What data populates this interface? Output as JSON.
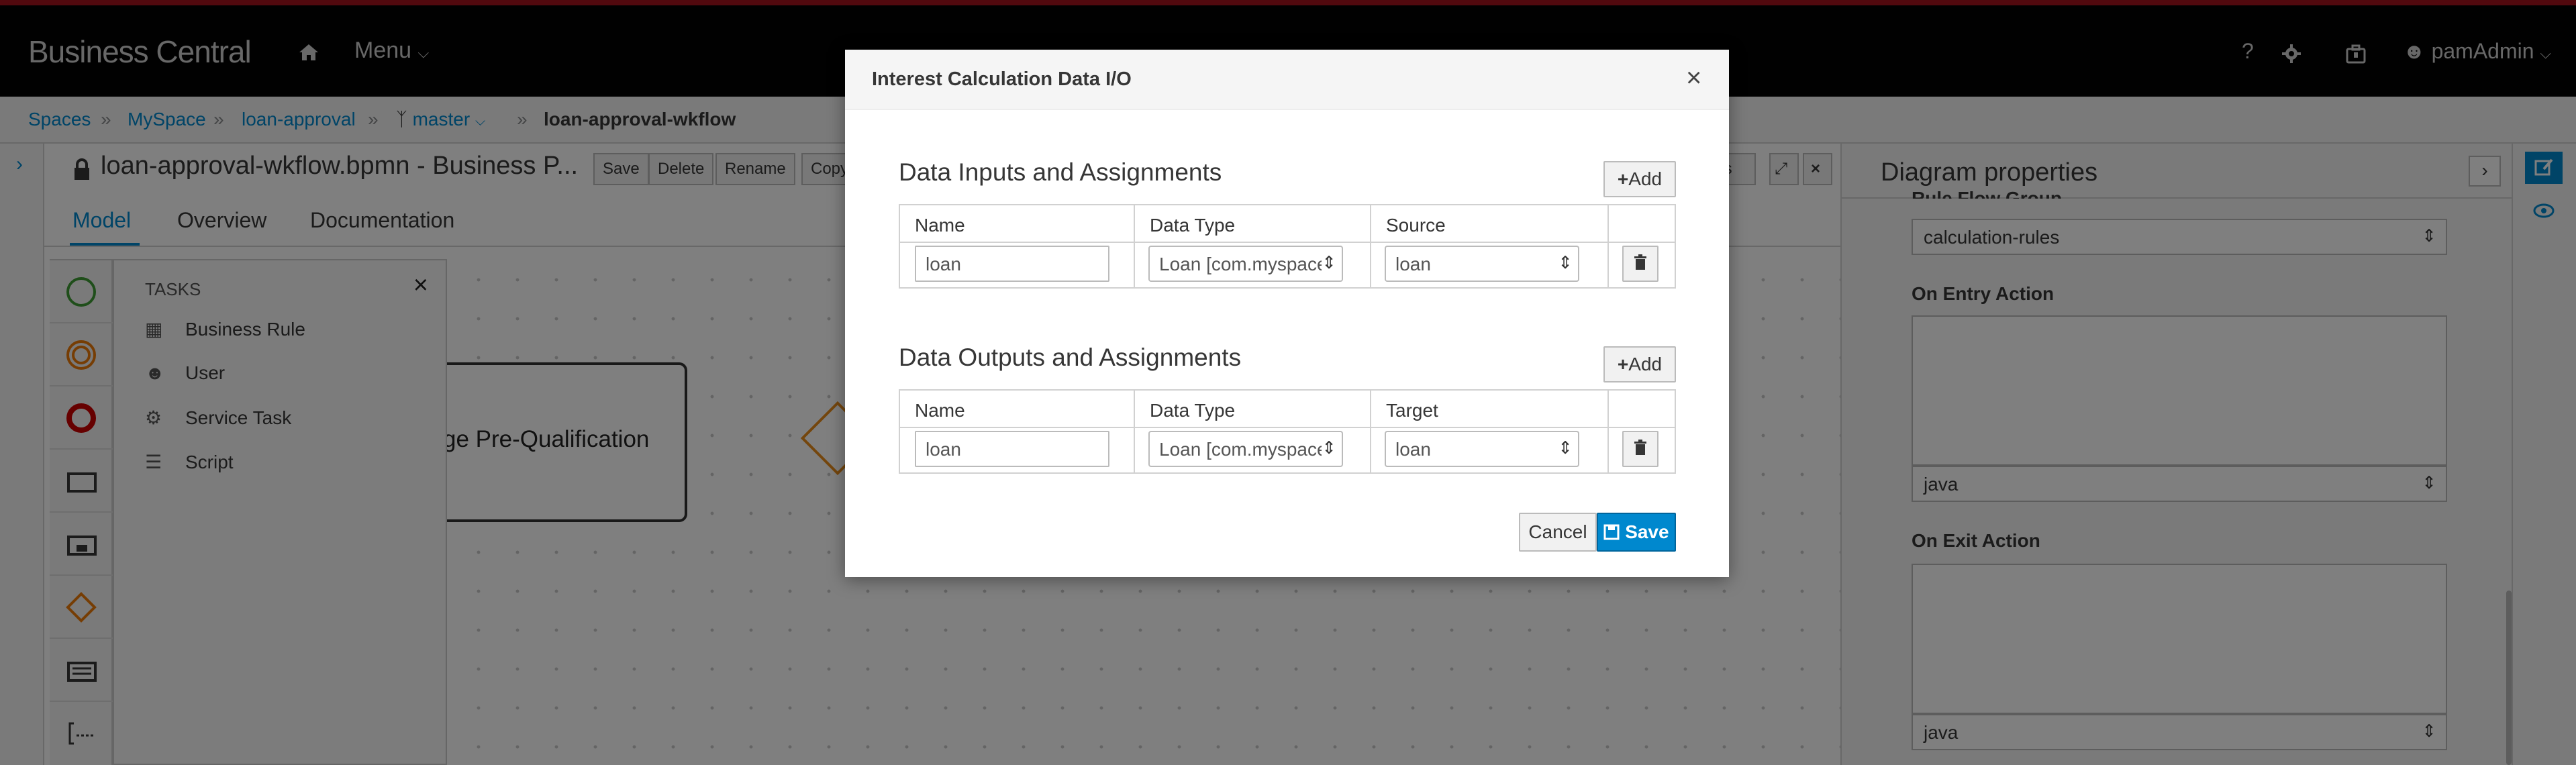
{
  "app": {
    "brand": "Business Central",
    "menu_label": "Menu",
    "help_label": "?",
    "user_label": "pamAdmin"
  },
  "breadcrumb": {
    "items": [
      "Spaces",
      "MySpace",
      "loan-approval",
      "master"
    ],
    "current": "loan-approval-wkflow"
  },
  "editor": {
    "title": "loan-approval-wkflow.bpmn - Business P...",
    "toolbar": [
      "Save",
      "Delete",
      "Rename",
      "Copy"
    ],
    "toolbar_right_partial": "rts",
    "tabs": [
      "Model",
      "Overview",
      "Documentation"
    ],
    "active_tab": "Model"
  },
  "palette": {
    "flyout_title": "TASKS",
    "items": [
      "Business Rule",
      "User",
      "Service Task",
      "Script"
    ]
  },
  "canvas": {
    "task_label": "ge Pre-Qualification"
  },
  "properties": {
    "title": "Diagram properties",
    "rule_flow_group_label": "Rule Flow Group",
    "rule_flow_group_value": "calculation-rules",
    "on_entry_label": "On Entry Action",
    "on_entry_lang": "java",
    "on_exit_label": "On Exit Action",
    "on_exit_lang": "java"
  },
  "dialog": {
    "title": "Interest Calculation Data I/O",
    "close_symbol": "×",
    "inputs": {
      "title": "Data Inputs and Assignments",
      "add_label": "Add",
      "columns": [
        "Name",
        "Data Type",
        "Source"
      ],
      "rows": [
        {
          "name": "loan",
          "data_type": "Loan [com.myspace",
          "source": "loan"
        }
      ]
    },
    "outputs": {
      "title": "Data Outputs and Assignments",
      "add_label": "Add",
      "columns": [
        "Name",
        "Data Type",
        "Target"
      ],
      "rows": [
        {
          "name": "loan",
          "data_type": "Loan [com.myspace",
          "target": "loan"
        }
      ]
    },
    "cancel_label": "Cancel",
    "save_label": "Save"
  },
  "colors": {
    "accent": "#0088ce",
    "navbar": "#030303",
    "navbar_top_border": "#a3121c",
    "gateway": "#e88d1a",
    "start_event": "#3f9c35",
    "intermediate_event": "#ec7a08",
    "end_event": "#cc0000"
  }
}
